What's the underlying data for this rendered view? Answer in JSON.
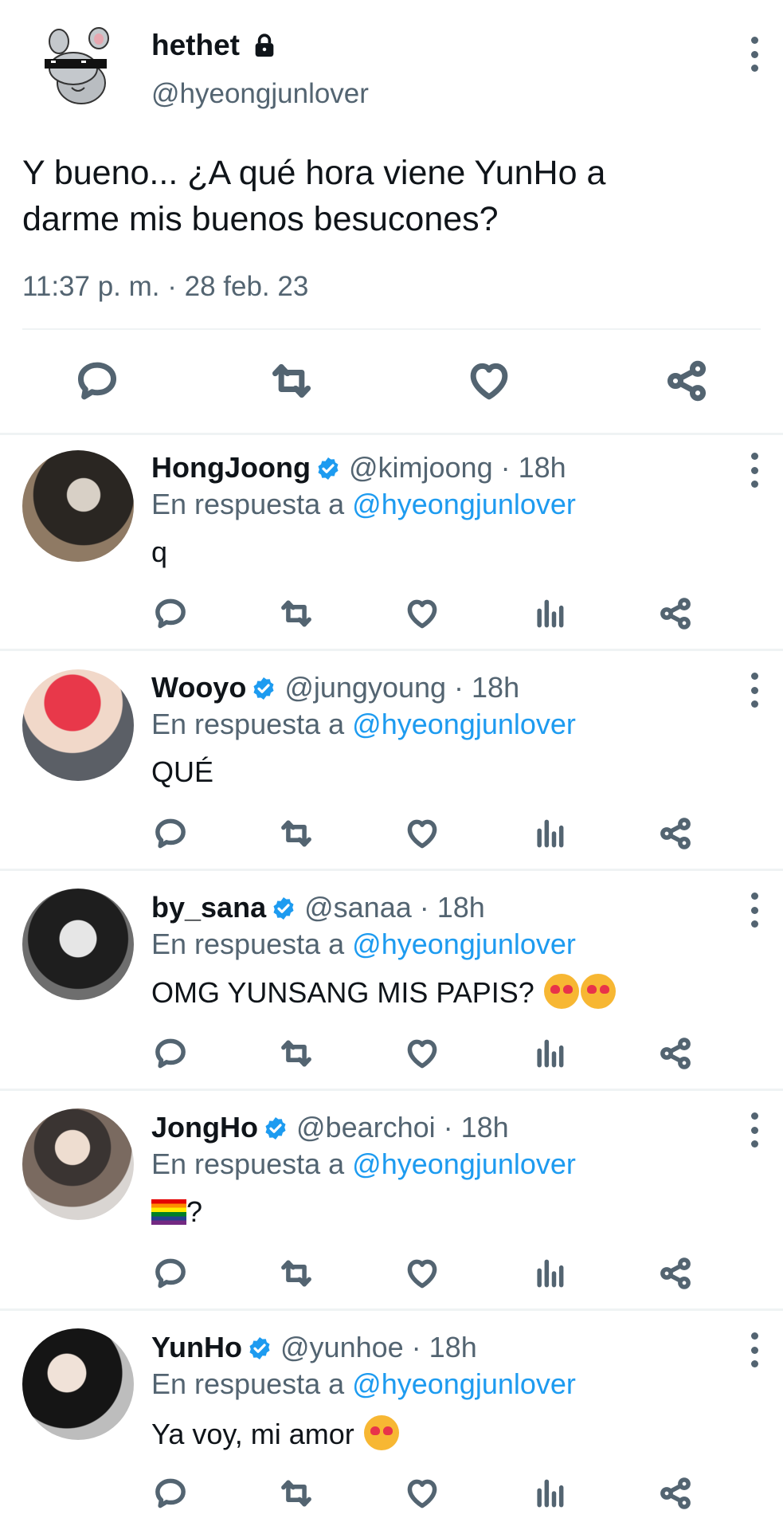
{
  "main_tweet": {
    "display_name": "hethet",
    "handle": "@hyeongjunlover",
    "text_line1": "Y bueno... ¿A qué hora viene YunHo a",
    "text_line2": "darme mis buenos besucones?",
    "timestamp": "11:37 p. m. · 28 feb. 23"
  },
  "reply_prefix": "En respuesta a",
  "reply_target": "@hyeongjunlover",
  "replies": [
    {
      "name": "HongJoong",
      "handle": "@kimjoong · 18h",
      "text": "q",
      "emoji": ""
    },
    {
      "name": "Wooyo",
      "handle": "@jungyoung · 18h",
      "text": "QUÉ",
      "emoji": ""
    },
    {
      "name": "by_sana",
      "handle": "@sanaa · 18h",
      "text": "OMG YUNSANG MIS PAPIS?",
      "emoji": "heart-eyes-cat x2"
    },
    {
      "name": "JongHo",
      "handle": "@bearchoi · 18h",
      "text": "?",
      "emoji": "rainbow-flag"
    },
    {
      "name": "YunHo",
      "handle": "@yunhoe · 18h",
      "text": "Ya voy, mi amor",
      "emoji": "heart-eyes-cat"
    }
  ],
  "colors": {
    "accent": "#1d9bf0",
    "muted": "#536471",
    "text": "#0f1419",
    "divider": "#eff3f4"
  }
}
